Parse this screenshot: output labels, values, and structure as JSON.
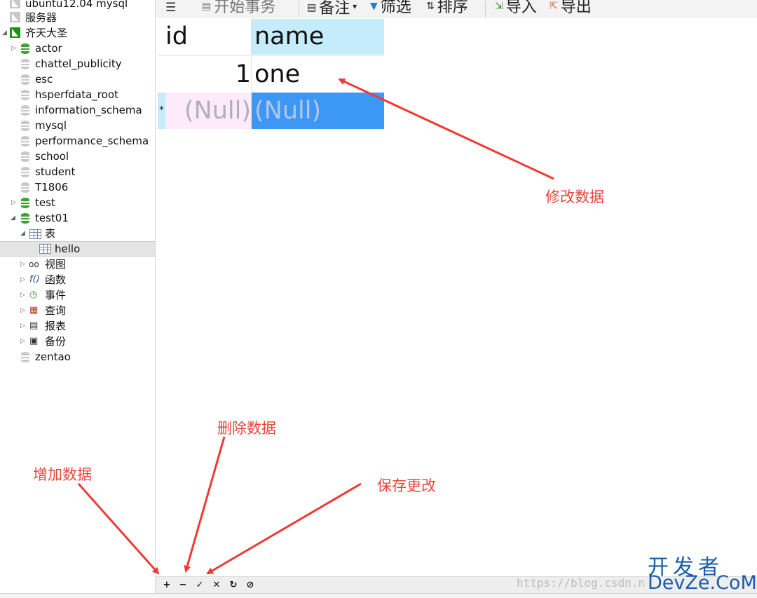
{
  "sidebar": {
    "items": [
      {
        "label": "ubuntu12.04 mysql",
        "icon": "connection-icon",
        "level": 0
      },
      {
        "label": "服务器",
        "icon": "connection-icon",
        "level": 0
      },
      {
        "label": "齐天大圣",
        "icon": "connection-icon",
        "level": 0,
        "expanded": true
      },
      {
        "label": "actor",
        "icon": "database-icon",
        "level": 1
      },
      {
        "label": "chattel_publicity",
        "icon": "database-icon",
        "level": 1
      },
      {
        "label": "esc",
        "icon": "database-icon",
        "level": 1
      },
      {
        "label": "hsperfdata_root",
        "icon": "database-icon",
        "level": 1
      },
      {
        "label": "information_schema",
        "icon": "database-icon",
        "level": 1
      },
      {
        "label": "mysql",
        "icon": "database-icon",
        "level": 1
      },
      {
        "label": "performance_schema",
        "icon": "database-icon",
        "level": 1
      },
      {
        "label": "school",
        "icon": "database-icon",
        "level": 1
      },
      {
        "label": "student",
        "icon": "database-icon",
        "level": 1
      },
      {
        "label": "T1806",
        "icon": "database-icon",
        "level": 1
      },
      {
        "label": "test",
        "icon": "database-icon",
        "level": 1
      },
      {
        "label": "test01",
        "icon": "database-icon",
        "level": 1,
        "expanded": true
      },
      {
        "label": "表",
        "icon": "table-icon",
        "level": 2,
        "expanded": true
      },
      {
        "label": "hello",
        "icon": "table-icon",
        "level": 3,
        "selected": true
      },
      {
        "label": "视图",
        "icon": "view-icon",
        "level": 2
      },
      {
        "label": "函数",
        "icon": "function-icon",
        "level": 2
      },
      {
        "label": "事件",
        "icon": "event-icon",
        "level": 2
      },
      {
        "label": "查询",
        "icon": "query-icon",
        "level": 2
      },
      {
        "label": "报表",
        "icon": "report-icon",
        "level": 2
      },
      {
        "label": "备份",
        "icon": "backup-icon",
        "level": 2
      },
      {
        "label": "zentao",
        "icon": "database-icon",
        "level": 1
      }
    ]
  },
  "toolbar": {
    "menu_icon": "☰",
    "begin_transaction": "开始事务",
    "memo": "备注",
    "filter": "筛选",
    "sort": "排序",
    "import": "导入",
    "export": "导出"
  },
  "grid": {
    "columns": [
      "id",
      "name"
    ],
    "rows": [
      {
        "marker": "",
        "id": "1",
        "name": "one"
      },
      {
        "marker": "*",
        "id": "(Null)",
        "name": "(Null)"
      }
    ]
  },
  "bottom_bar": {
    "buttons": [
      "+",
      "−",
      "✓",
      "✕",
      "↻",
      "⊘"
    ]
  },
  "annotations": {
    "edit": "修改数据",
    "delete": "删除数据",
    "add": "增加数据",
    "save": "保存更改"
  },
  "watermark": "https://blog.csdn.n",
  "logo": {
    "top": "开发者",
    "bottom": "DevZe.CoM"
  },
  "colors": {
    "annotation": "#e8453c",
    "header_selected": "#c5ecfb",
    "cell_selected": "#3d97f5",
    "logo": "#1a5ea9"
  }
}
